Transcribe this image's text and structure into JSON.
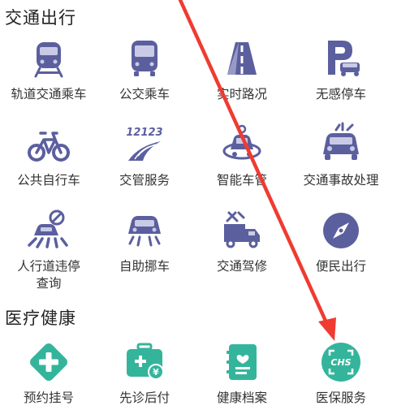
{
  "sections": [
    {
      "title": "交通出行",
      "items": [
        {
          "label": "轨道交通乘车",
          "icon": "train-icon"
        },
        {
          "label": "公交乘车",
          "icon": "bus-icon"
        },
        {
          "label": "实时路况",
          "icon": "road-icon"
        },
        {
          "label": "无感停车",
          "icon": "parking-icon"
        },
        {
          "label": "公共自行车",
          "icon": "bicycle-icon"
        },
        {
          "label": "交管服务",
          "icon": "traffic-management-icon"
        },
        {
          "label": "智能车管",
          "icon": "smart-car-icon"
        },
        {
          "label": "交通事故处理",
          "icon": "car-accident-icon"
        },
        {
          "label": "人行道违停",
          "label2": "查询",
          "icon": "crosswalk-no-parking-icon"
        },
        {
          "label": "自助挪车",
          "icon": "move-car-icon"
        },
        {
          "label": "交通驾修",
          "icon": "truck-repair-icon"
        },
        {
          "label": "便民出行",
          "icon": "compass-icon"
        }
      ]
    },
    {
      "title": "医疗健康",
      "items": [
        {
          "label": "预约挂号",
          "icon": "medical-cross-icon"
        },
        {
          "label": "先诊后付",
          "icon": "medical-kit-payment-icon"
        },
        {
          "label": "健康档案",
          "icon": "health-record-icon"
        },
        {
          "label": "医保服务",
          "icon": "chs-insurance-icon"
        }
      ]
    }
  ],
  "icons": {
    "traffic_color": "#5b5f9e",
    "traffic_light_color": "#c9cbe6",
    "health_color": "#34b59b",
    "arrow_color": "#ef3b31",
    "chs_text": "CHS",
    "traffic_sign_text": "12123"
  }
}
